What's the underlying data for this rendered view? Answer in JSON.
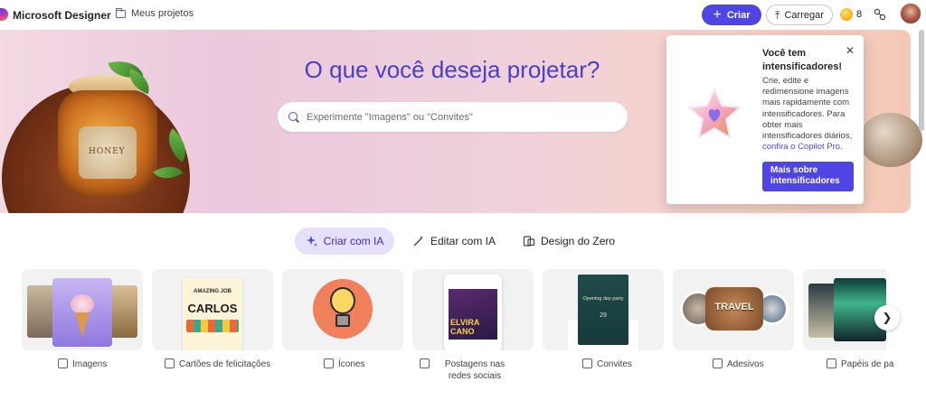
{
  "header": {
    "brand": "Microsoft Designer",
    "projects_label": "Meus projetos",
    "create_label": "Criar",
    "upload_label": "Carregar",
    "boost_count": "8"
  },
  "hero": {
    "title": "O que você deseja projetar?",
    "search_placeholder": "Experimente \"Imagens\" ou \"Convites\"",
    "jar_label": "HONEY"
  },
  "popover": {
    "title": "Você tem intensificadores!",
    "body": "Crie, edite e redimensione imagens mais rapidamente com intensificadores. Para obter mais intensificadores diários,",
    "link": "confira o Copilot Pro.",
    "button": "Mais sobre intensificadores"
  },
  "tabs": [
    {
      "label": "Criar com IA",
      "icon": "sparkle-icon"
    },
    {
      "label": "Editar com IA",
      "icon": "magic-wand-icon"
    },
    {
      "label": "Design do Zero",
      "icon": "layout-icon"
    }
  ],
  "cards": [
    {
      "label": "Imagens",
      "icon": "image-sparkle-icon"
    },
    {
      "label": "Cartões de felicitações",
      "icon": "envelope-icon"
    },
    {
      "label": "Ícones",
      "icon": "icons-icon"
    },
    {
      "label": "Postagens nas redes sociais",
      "icon": "social-post-icon"
    },
    {
      "label": "Convites",
      "icon": "invitation-icon"
    },
    {
      "label": "Adesivos",
      "icon": "sticker-icon"
    },
    {
      "label": "Papéis de pa",
      "icon": "wallpaper-icon"
    }
  ],
  "card_art": {
    "greeting_line1": "AMAZING JOB",
    "greeting_name": "CARLOS",
    "social_name1": "ELVIRA",
    "social_name2": "CANO",
    "invite_title": "Opening day party",
    "invite_day": "29",
    "sticker_text": "TRAVEL"
  },
  "colors": {
    "accent": "#4f45e4",
    "hero_title": "#4a3fc8",
    "tab_active_bg": "#e7e0fb"
  }
}
